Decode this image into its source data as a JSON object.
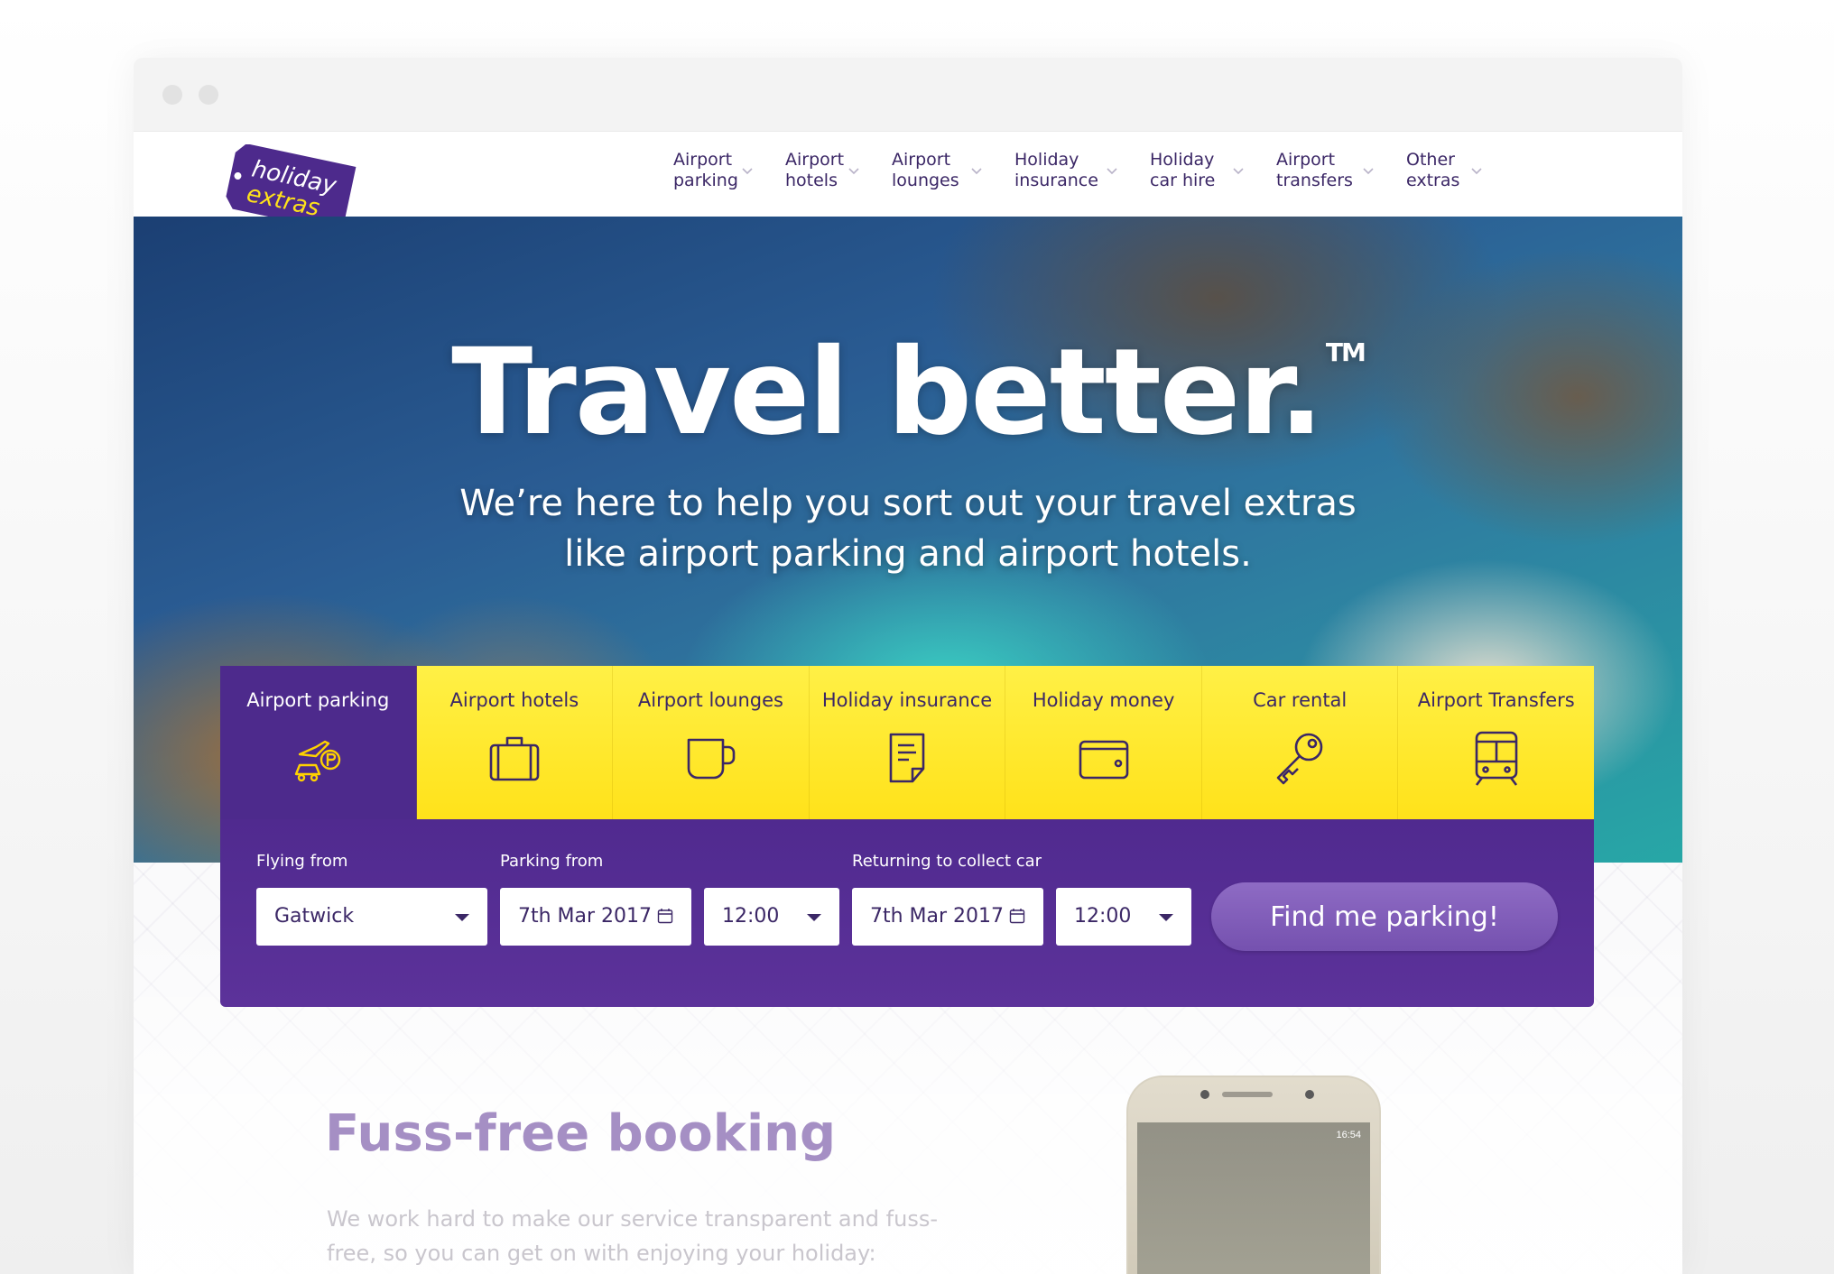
{
  "logo": {
    "line1": "holiday",
    "line2": "extras"
  },
  "nav": [
    {
      "label": "Airport\nparking"
    },
    {
      "label": "Airport\nhotels"
    },
    {
      "label": "Airport\nlounges"
    },
    {
      "label": "Holiday\ninsurance"
    },
    {
      "label": "Holiday\ncar hire"
    },
    {
      "label": "Airport\ntransfers"
    },
    {
      "label": "Other\nextras"
    }
  ],
  "hero": {
    "title": "Travel better.",
    "trademark": "TM",
    "subtitle": "We’re here to help you sort out your travel extras\nlike airport parking and airport hotels."
  },
  "tabs": [
    {
      "label": "Airport parking",
      "icon": "parking-car-icon",
      "active": true
    },
    {
      "label": "Airport hotels",
      "icon": "suitcase-icon"
    },
    {
      "label": "Airport lounges",
      "icon": "cup-icon"
    },
    {
      "label": "Holiday insurance",
      "icon": "document-icon"
    },
    {
      "label": "Holiday money",
      "icon": "wallet-icon"
    },
    {
      "label": "Car rental",
      "icon": "key-icon"
    },
    {
      "label": "Airport Transfers",
      "icon": "train-icon"
    }
  ],
  "form": {
    "flying_from_label": "Flying from",
    "flying_from_value": "Gatwick",
    "parking_from_label": "Parking from",
    "parking_date": "7th Mar 2017",
    "parking_time": "12:00",
    "returning_label": "Returning to collect car",
    "return_date": "7th Mar 2017",
    "return_time": "12:00",
    "submit": "Find me parking!"
  },
  "section": {
    "title": "Fuss-free booking",
    "text": "We work hard to make our service transparent and fuss-\nfree, so you can get on with enjoying your holiday:"
  },
  "phone": {
    "status_time": "16:54"
  },
  "colors": {
    "brand_purple": "#4d2a8c",
    "brand_yellow": "#ffe21a",
    "button_purple": "#7e5ab8"
  }
}
